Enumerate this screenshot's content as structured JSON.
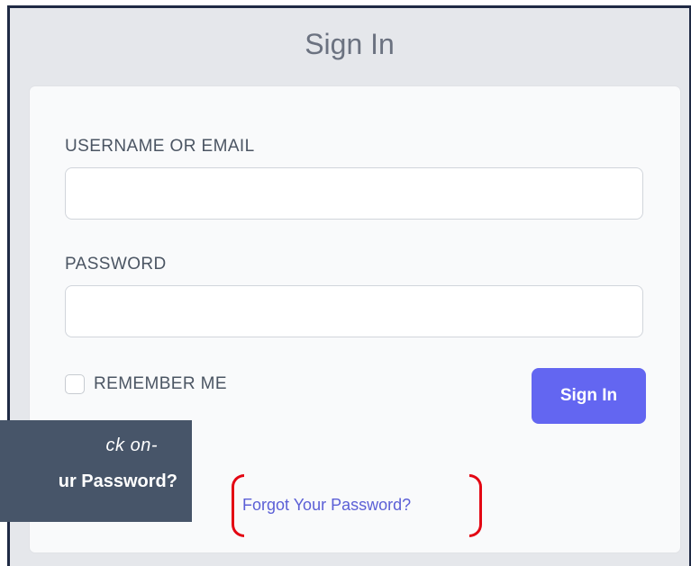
{
  "header": {
    "title": "Sign In"
  },
  "form": {
    "username_label": "USERNAME OR EMAIL",
    "username_value": "",
    "password_label": "PASSWORD",
    "password_value": "",
    "remember_label": "REMEMBER ME",
    "remember_checked": false,
    "submit_label": "Sign In",
    "forgot_label": "Forgot Your Password?"
  },
  "annotation": {
    "line1": "ck on-",
    "line2": "ur Password?"
  },
  "colors": {
    "accent": "#6366f1",
    "link": "#5b5fd6",
    "highlight": "#e30613",
    "callout_bg": "#475569",
    "frame": "#1f2a44"
  }
}
